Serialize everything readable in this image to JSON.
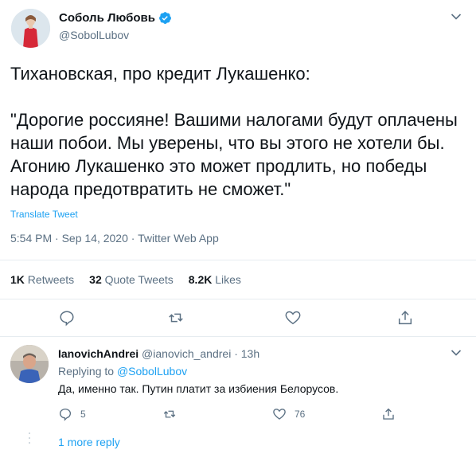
{
  "tweet": {
    "author_name": "Соболь Любовь",
    "author_handle": "@SobolLubov",
    "verified_icon": "verified-badge-icon",
    "text": "Тихановская, про кредит Лукашенко:\n\n\"Дорогие россияне! Вашими налогами будут оплачены наши побои. Мы уверены, что вы этого не хотели бы. Агонию Лукашенко это может продлить, но победы народа предотвратить не сможет.\"",
    "translate_label": "Translate Tweet",
    "meta": "5:54 PM · Sep 14, 2020 · Twitter Web App",
    "stats": {
      "retweets_count": "1K",
      "retweets_label": "Retweets",
      "quotes_count": "32",
      "quotes_label": "Quote Tweets",
      "likes_count": "8.2K",
      "likes_label": "Likes"
    }
  },
  "reply": {
    "name": "IanovichAndrei",
    "handle": "@ianovich_andrei",
    "time": "· 13h",
    "replying_label": "Replying to",
    "replying_mention": "@SobolLubov",
    "text": "Да, именно так. Путин платит за избиения Белорусов.",
    "reply_count": "5",
    "like_count": "76"
  },
  "more_replies_label": "1 more reply",
  "colors": {
    "accent": "#1da1f2",
    "secondary_text": "#5b7083",
    "border": "#e6ecf0"
  }
}
